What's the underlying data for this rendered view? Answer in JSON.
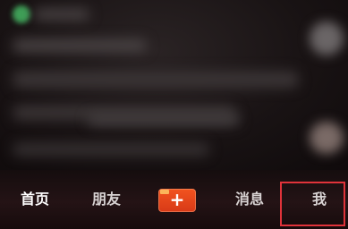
{
  "tabbar": {
    "home_label": "首页",
    "friends_label": "朋友",
    "add_symbol": "+",
    "messages_label": "消息",
    "me_label": "我"
  },
  "colors": {
    "accent": "#e84a1e",
    "highlight_box": "#e0333a"
  },
  "icons": {
    "add": "plus-icon"
  }
}
